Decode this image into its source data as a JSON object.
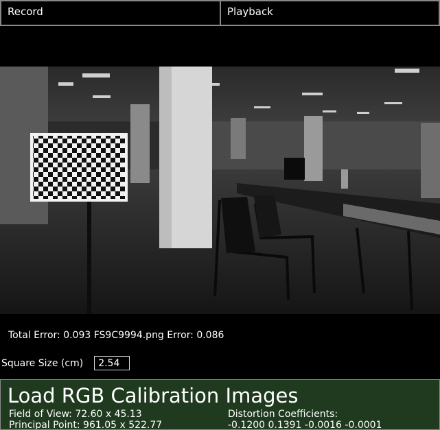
{
  "tabs": [
    {
      "label": "Record"
    },
    {
      "label": "Playback"
    }
  ],
  "status": {
    "error_text": "Total Error: 0.093  FS9C9994.png  Error: 0.086"
  },
  "square_size": {
    "label": "Square Size (cm)",
    "value": "2.54"
  },
  "calibration": {
    "title": "Load RGB Calibration Images",
    "fov_text": "Field of View: 72.60 x 45.13",
    "principal_text": "Principal Point: 961.05 x 522.77",
    "distortion_label": "Distortion Coefficients:",
    "distortion_values": "-0.1200  0.1391  -0.0016  -0.0001"
  },
  "colors": {
    "panel_bg": "#1f3a1f",
    "border": "#888888"
  }
}
